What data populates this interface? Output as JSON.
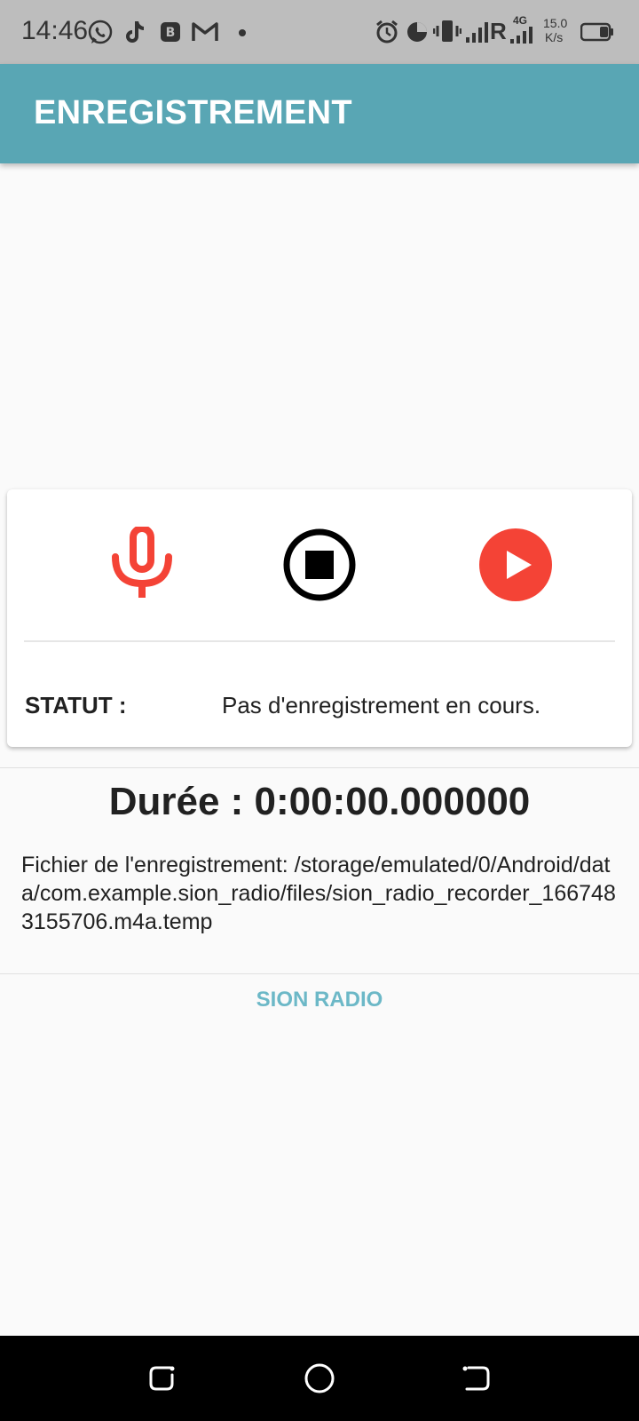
{
  "status_bar": {
    "time": "14:46",
    "network_speed_value": "15.0",
    "network_speed_unit": "K/s",
    "roaming_label": "R",
    "network_type": "4G",
    "icons": [
      "whatsapp-icon",
      "tiktok-icon",
      "app-b-icon",
      "gmail-icon",
      "dot-icon",
      "alarm-icon",
      "data-saver-icon",
      "vibrate-icon",
      "signal-icon",
      "battery-icon"
    ]
  },
  "app_bar": {
    "title": "ENREGISTREMENT",
    "color": "#59a6b4"
  },
  "controls": {
    "record_icon": "microphone-icon",
    "stop_icon": "stop-circle-icon",
    "play_icon": "play-circle-icon",
    "accent_color": "#f44336"
  },
  "status": {
    "label": "STATUT :",
    "value": "Pas d'enregistrement en cours."
  },
  "duration": {
    "text": "Durée : 0:00:00.000000"
  },
  "file": {
    "text": "Fichier de l'enregistrement: /storage/emulated/0/Android/data/com.example.sion_radio/files/sion_radio_recorder_1667483155706.m4a.temp"
  },
  "footer": {
    "label": "SION RADIO",
    "color": "#6cb8c7"
  },
  "nav_bar": {
    "icons": [
      "recents-icon",
      "home-icon",
      "back-icon"
    ]
  }
}
